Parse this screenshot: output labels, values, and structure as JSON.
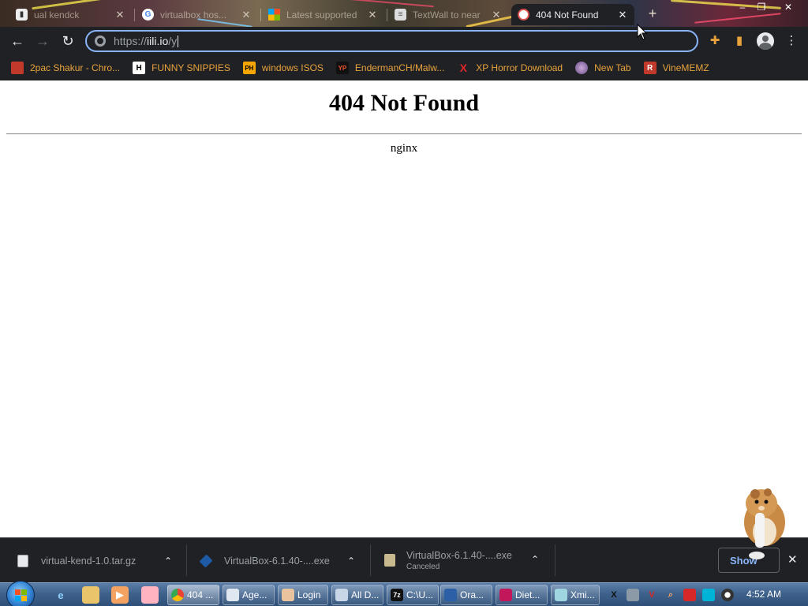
{
  "browser": {
    "tabs": [
      {
        "label": "ual kendck",
        "favicon": "file-icon",
        "active": false
      },
      {
        "label": "virtualbox hos...",
        "favicon": "google-icon",
        "active": false
      },
      {
        "label": "Latest supported",
        "favicon": "microsoft-icon",
        "active": false
      },
      {
        "label": "TextWall to near",
        "favicon": "textwall-icon",
        "active": false
      },
      {
        "label": "404 Not Found",
        "favicon": "page-icon",
        "active": true
      }
    ],
    "new_tab_label": "+",
    "close_glyph": "✕",
    "address": {
      "scheme": "https://",
      "host": "iili.io",
      "path": "/y"
    },
    "bookmarks": [
      {
        "label": "2pac Shakur - Chro...",
        "icon": "2pac-icon"
      },
      {
        "label": "FUNNY SNIPPIES",
        "icon": "h-icon",
        "icon_text": "H"
      },
      {
        "label": "windows ISOS",
        "icon": "ph-icon",
        "icon_text": "PH"
      },
      {
        "label": "EndermanCH/Malw...",
        "icon": "yp-icon",
        "icon_text": "YP"
      },
      {
        "label": "XP Horror Download",
        "icon": "x-icon",
        "icon_text": "X"
      },
      {
        "label": "New Tab",
        "icon": "globe-icon"
      },
      {
        "label": "VineMEMZ",
        "icon": "r-icon",
        "icon_text": "R"
      }
    ]
  },
  "page": {
    "heading": "404 Not Found",
    "server": "nginx"
  },
  "downloads": {
    "items": [
      {
        "name": "virtual-kend-1.0.tar.gz",
        "status": ""
      },
      {
        "name": "VirtualBox-6.1.40-....exe",
        "status": ""
      },
      {
        "name": "VirtualBox-6.1.40-....exe",
        "status": "Canceled"
      }
    ],
    "show_all_label": "Show"
  },
  "taskbar": {
    "items": [
      {
        "label": "404 ...",
        "active": true
      },
      {
        "label": "Age...",
        "active": false
      },
      {
        "label": "Login",
        "active": false
      },
      {
        "label": "All D...",
        "active": false
      },
      {
        "label": "C:\\U...",
        "active": false
      },
      {
        "label": "Ora...",
        "active": false
      },
      {
        "label": "Diet...",
        "active": false
      },
      {
        "label": "Xmi...",
        "active": false
      }
    ],
    "clock": "4:52 AM"
  },
  "colors": {
    "chrome_dark": "#202124",
    "accent_blue": "#8ab4f8",
    "bookmark_text": "#e8a33c"
  }
}
